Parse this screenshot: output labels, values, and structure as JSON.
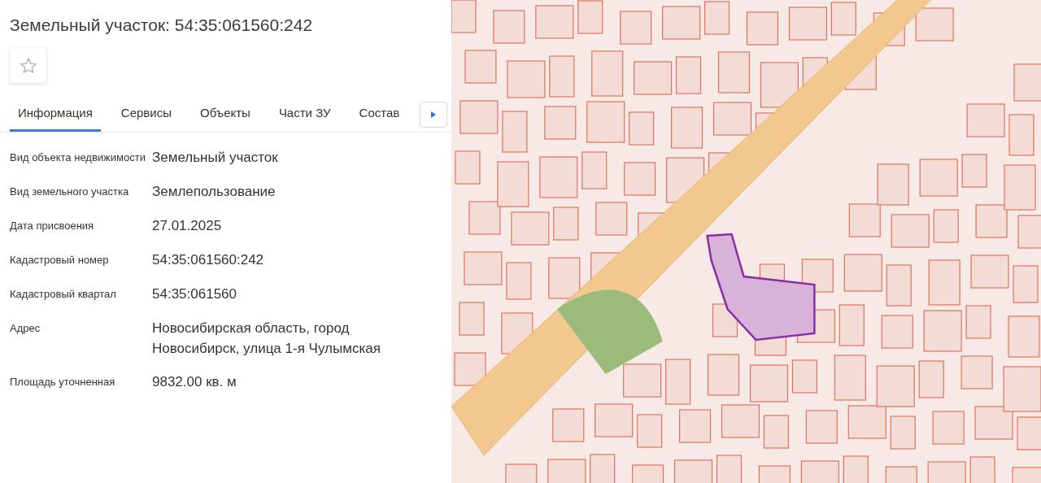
{
  "title": "Земельный участок: 54:35:061560:242",
  "tabs": [
    {
      "label": "Информация",
      "selected": true
    },
    {
      "label": "Сервисы",
      "selected": false
    },
    {
      "label": "Объекты",
      "selected": false
    },
    {
      "label": "Части ЗУ",
      "selected": false
    },
    {
      "label": "Состав",
      "selected": false
    }
  ],
  "properties": [
    {
      "label": "Вид объекта недвижимости",
      "value": "Земельный участок"
    },
    {
      "label": "Вид земельного участка",
      "value": "Землепользование"
    },
    {
      "label": "Дата присвоения",
      "value": "27.01.2025"
    },
    {
      "label": "Кадастровый номер",
      "value": "54:35:061560:242"
    },
    {
      "label": "Кадастровый квартал",
      "value": "54:35:061560"
    },
    {
      "label": "Адрес",
      "value": "Новосибирская область, город Новосибирск, улица 1-я Чулымская"
    },
    {
      "label": "Площадь уточненная",
      "value": "9832.00 кв. м"
    }
  ]
}
